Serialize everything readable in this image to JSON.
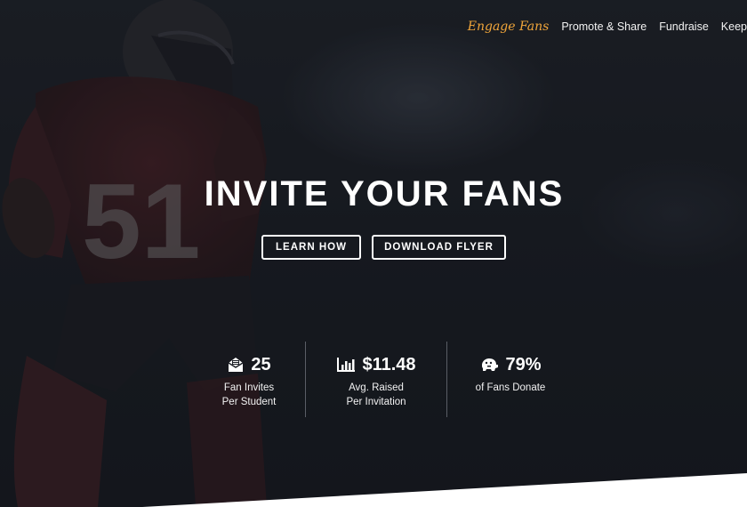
{
  "nav": {
    "brand": "Engage Fans",
    "items": [
      "Promote & Share",
      "Fundraise",
      "Keep"
    ]
  },
  "hero": {
    "title": "INVITE YOUR FANS",
    "buttons": {
      "learn": "LEARN HOW",
      "download": "DOWNLOAD FLYER"
    }
  },
  "stats": [
    {
      "icon": "envelope-invite-icon",
      "value": "25",
      "label_line1": "Fan Invites",
      "label_line2": "Per Student"
    },
    {
      "icon": "bar-chart-icon",
      "value": "$11.48",
      "label_line1": "Avg. Raised",
      "label_line2": "Per Invitation"
    },
    {
      "icon": "piggy-bank-icon",
      "value": "79%",
      "label_line1": "of Fans Donate",
      "label_line2": ""
    }
  ],
  "colors": {
    "brand_accent": "#f0a53a",
    "background": "#1a1d24",
    "text": "#ffffff"
  }
}
